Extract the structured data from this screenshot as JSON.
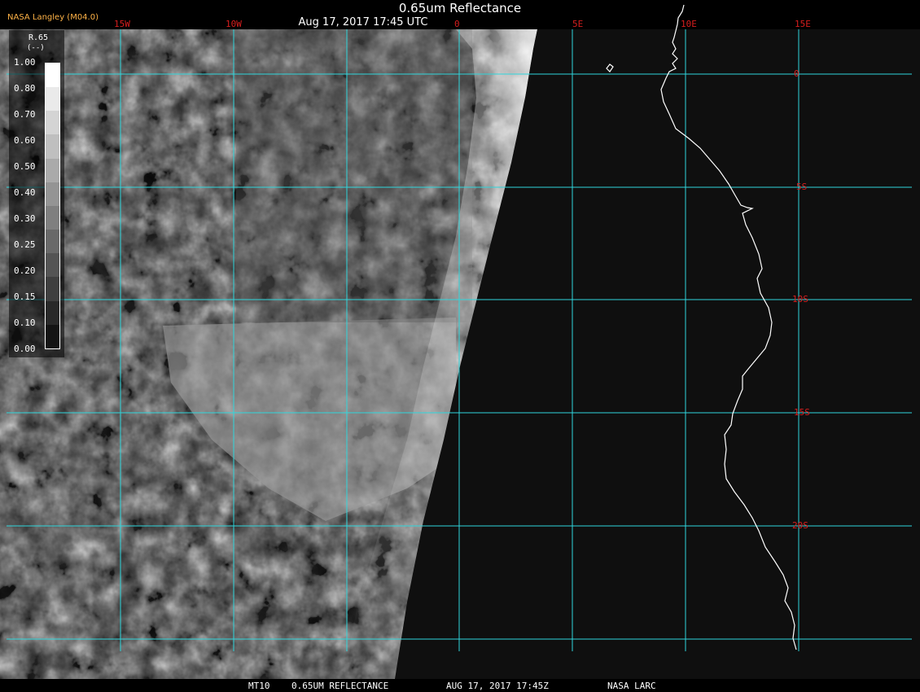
{
  "header": {
    "title": "0.65um Reflectance",
    "time": "Aug 17, 2017 17:45 UTC",
    "org": "NASA Langley (M04.0)"
  },
  "footer": {
    "satellite": "MT10",
    "product": "0.65UM REFLECTANCE",
    "datetime": "AUG 17, 2017 17:45Z",
    "source": "NASA LARC"
  },
  "grid": {
    "lon_labels": [
      "15W",
      "10W",
      "0",
      "5E",
      "10E",
      "15E"
    ],
    "lat_labels": [
      "0",
      "5S",
      "10S",
      "15S",
      "20S"
    ]
  },
  "legend": {
    "title": "R.65",
    "units": "(--)",
    "ticks": [
      "1.00",
      "0.80",
      "0.70",
      "0.60",
      "0.50",
      "0.40",
      "0.30",
      "0.25",
      "0.20",
      "0.15",
      "0.10",
      "0.00"
    ]
  },
  "colors": {
    "grid": "#2fd6dc",
    "grid_label": "#d81e1e",
    "coastline": "#ffffff",
    "org_label": "#ffb347",
    "space": "#0f0f0f"
  }
}
